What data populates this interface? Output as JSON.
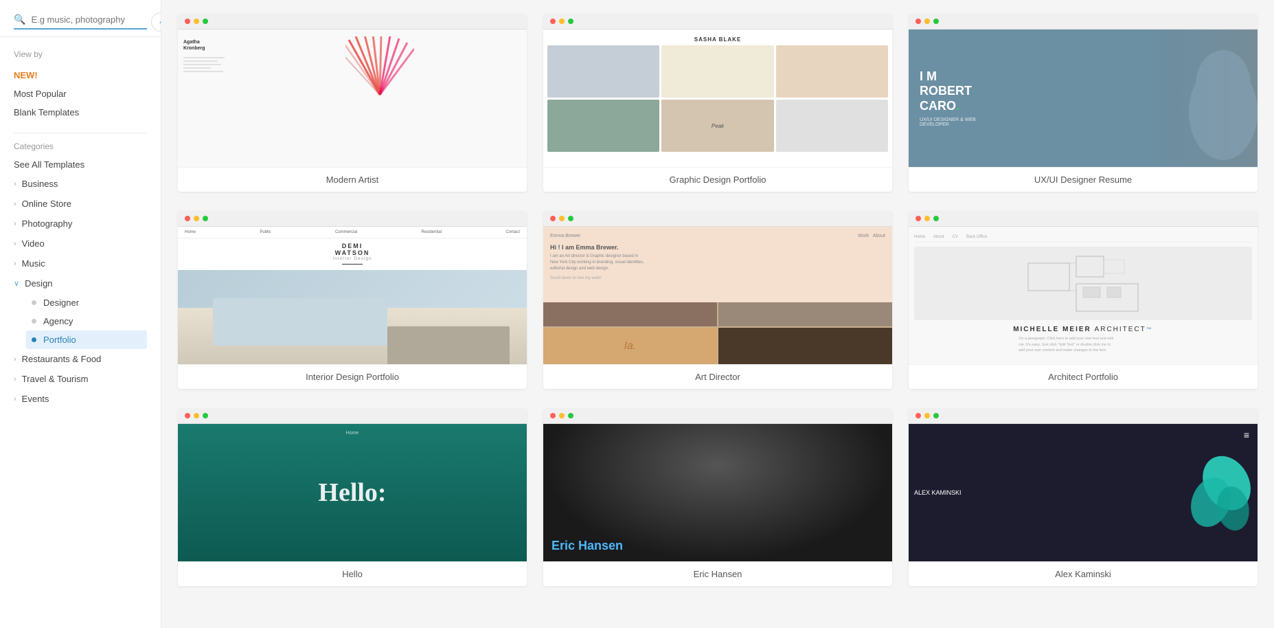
{
  "sidebar": {
    "collapse_icon": "‹",
    "search": {
      "placeholder": "E.g music, photography"
    },
    "viewby": {
      "title": "View by",
      "items": [
        {
          "id": "new",
          "label": "NEW!",
          "special": "new"
        },
        {
          "id": "most-popular",
          "label": "Most Popular",
          "special": ""
        },
        {
          "id": "blank-templates",
          "label": "Blank Templates",
          "special": ""
        }
      ]
    },
    "categories": {
      "title": "Categories",
      "see_all": "See All Templates",
      "items": [
        {
          "id": "business",
          "label": "Business",
          "expanded": false,
          "children": []
        },
        {
          "id": "online-store",
          "label": "Online Store",
          "expanded": false,
          "children": []
        },
        {
          "id": "photography",
          "label": "Photography",
          "expanded": false,
          "children": []
        },
        {
          "id": "video",
          "label": "Video",
          "expanded": false,
          "children": []
        },
        {
          "id": "music",
          "label": "Music",
          "expanded": false,
          "children": []
        },
        {
          "id": "design",
          "label": "Design",
          "expanded": true,
          "children": [
            {
              "id": "designer",
              "label": "Designer",
              "active": false
            },
            {
              "id": "agency",
              "label": "Agency",
              "active": false
            },
            {
              "id": "portfolio",
              "label": "Portfolio",
              "active": true
            }
          ]
        },
        {
          "id": "restaurants-food",
          "label": "Restaurants & Food",
          "expanded": false,
          "children": []
        },
        {
          "id": "travel-tourism",
          "label": "Travel & Tourism",
          "expanded": false,
          "children": []
        },
        {
          "id": "events",
          "label": "Events",
          "expanded": false,
          "children": []
        }
      ]
    }
  },
  "templates": {
    "cards": [
      {
        "id": "modern-artist",
        "label": "Modern Artist",
        "type": "modern-artist"
      },
      {
        "id": "graphic-design-portfolio",
        "label": "Graphic Design Portfolio",
        "type": "graphic-design-portfolio"
      },
      {
        "id": "uxui-designer-resume",
        "label": "UX/UI Designer Resume",
        "type": "uxui-designer-resume"
      },
      {
        "id": "interior-design-portfolio",
        "label": "Interior Design Portfolio",
        "type": "interior-design-portfolio"
      },
      {
        "id": "art-director",
        "label": "Art Director",
        "type": "art-director"
      },
      {
        "id": "architect-portfolio",
        "label": "Architect Portfolio",
        "type": "architect-portfolio"
      },
      {
        "id": "hello-template",
        "label": "Hello",
        "type": "hello"
      },
      {
        "id": "eric-hansen",
        "label": "Eric Hansen",
        "type": "eric-hansen"
      },
      {
        "id": "alex-kaminski",
        "label": "Alex Kaminski",
        "type": "alex-kaminski"
      }
    ]
  },
  "uxui": {
    "line1": "I M",
    "line2": "ROBERT",
    "line3": "CARO",
    "accent": ".",
    "subtitle": "UX/UI DESIGNER & WEB\nDEVELOPER"
  },
  "architect": {
    "name": "MICHELLE MEIER",
    "title": "ARCHITECT"
  },
  "interior": {
    "name": "DEMI",
    "surname": "WATSON",
    "subtitle": "Interior Design"
  },
  "art_director": {
    "name": "Emma Brewer",
    "links": "Work  About",
    "headline": "Hi ! I am Emma Brewer.",
    "description": "I am an Art director & Graphic designer based in New York City working in branding, visual identities, editorial design and web design.",
    "cta": "Scroll down to see my work!"
  },
  "eric": {
    "name": "Eric Hansen"
  },
  "alex": {
    "name": "ALEX KAMINSKI"
  }
}
